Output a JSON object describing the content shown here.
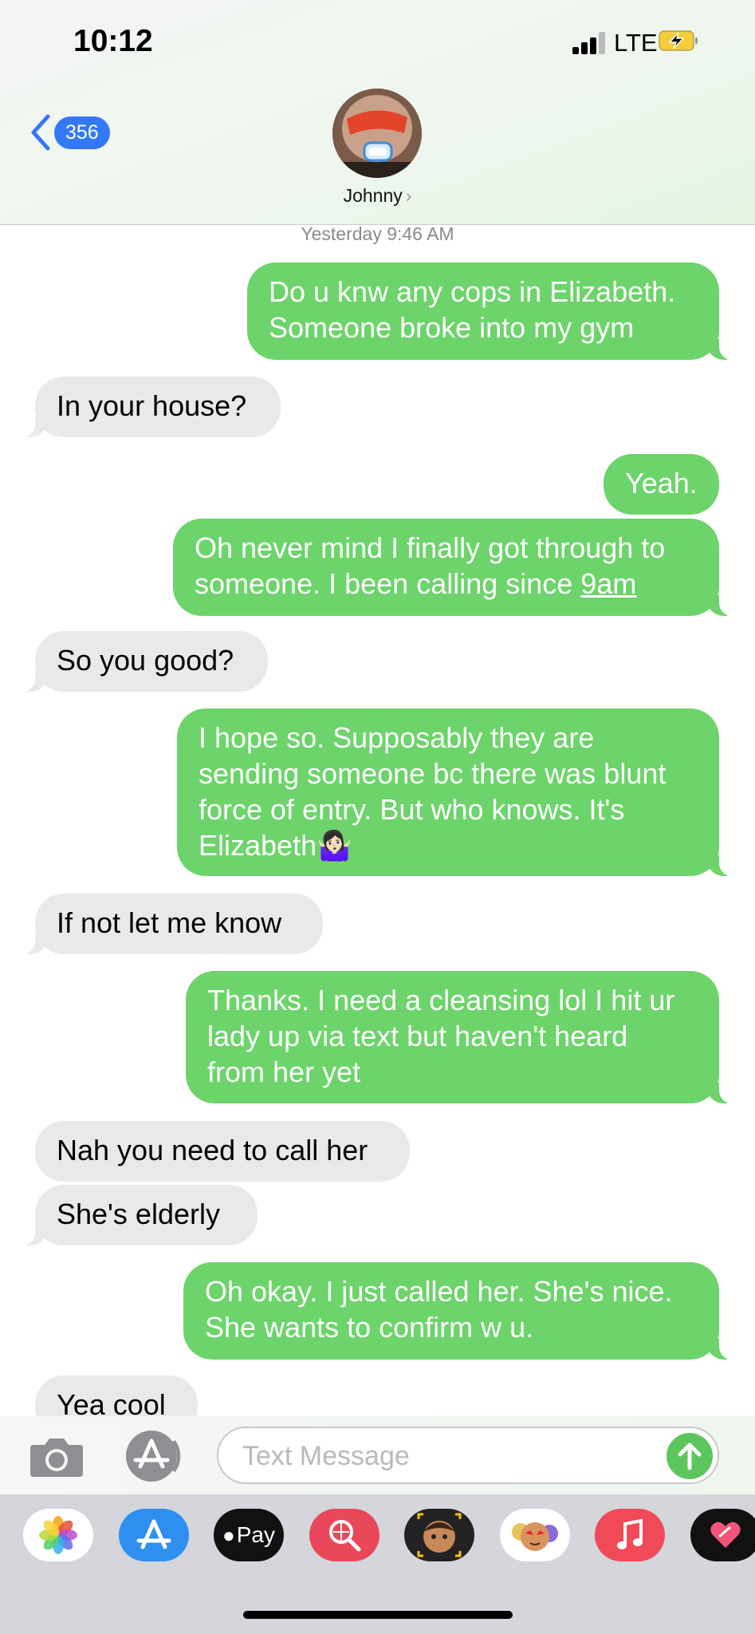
{
  "status_bar": {
    "time": "10:12",
    "network": "LTE"
  },
  "header": {
    "back_count": "356",
    "contact_name": "Johnny",
    "name_chevron": "›"
  },
  "thread": {
    "timestamp": "Yesterday 9:46 AM",
    "messages": [
      {
        "from": "me",
        "lines": [
          "Do u knw any cops in Elizabeth.",
          "Someone broke into my gym"
        ]
      },
      {
        "from": "them",
        "lines": [
          "In your house?"
        ]
      },
      {
        "from": "me",
        "lines": [
          "Yeah."
        ]
      },
      {
        "from": "me",
        "lines": [
          "Oh never mind I finally got through to",
          "someone.  I been calling since "
        ],
        "link": "9am"
      },
      {
        "from": "them",
        "lines": [
          "So you good?"
        ]
      },
      {
        "from": "me",
        "lines": [
          "I hope so. Supposably they are",
          "sending someone bc there was blunt",
          "force of entry. But who knows. It's",
          "Elizabeth🤷🏻‍♀️"
        ]
      },
      {
        "from": "them",
        "lines": [
          "If not let me know"
        ]
      },
      {
        "from": "me",
        "lines": [
          "Thanks. I need a cleansing lol I hit ur",
          "lady up via text but haven't heard",
          "from her yet"
        ]
      },
      {
        "from": "them",
        "lines": [
          "Nah you need to call her"
        ]
      },
      {
        "from": "them",
        "lines": [
          "She's elderly"
        ]
      },
      {
        "from": "me",
        "lines": [
          "Oh okay. I just called her. She's nice.",
          "She wants to confirm w u."
        ]
      },
      {
        "from": "them",
        "lines": [
          "Yea cool"
        ]
      }
    ]
  },
  "input": {
    "placeholder": "Text Message",
    "value": ""
  },
  "drawer": {
    "apps": [
      {
        "name": "photos-app-icon"
      },
      {
        "name": "app-store-icon"
      },
      {
        "name": "apple-pay-icon",
        "label": "Pay"
      },
      {
        "name": "image-search-icon"
      },
      {
        "name": "memoji-camera-icon"
      },
      {
        "name": "memoji-stickers-icon"
      },
      {
        "name": "music-icon"
      },
      {
        "name": "digital-touch-icon"
      }
    ]
  },
  "colors": {
    "sent": "#6cd46a",
    "received": "#e9e9eb",
    "accent": "#3478f6"
  }
}
